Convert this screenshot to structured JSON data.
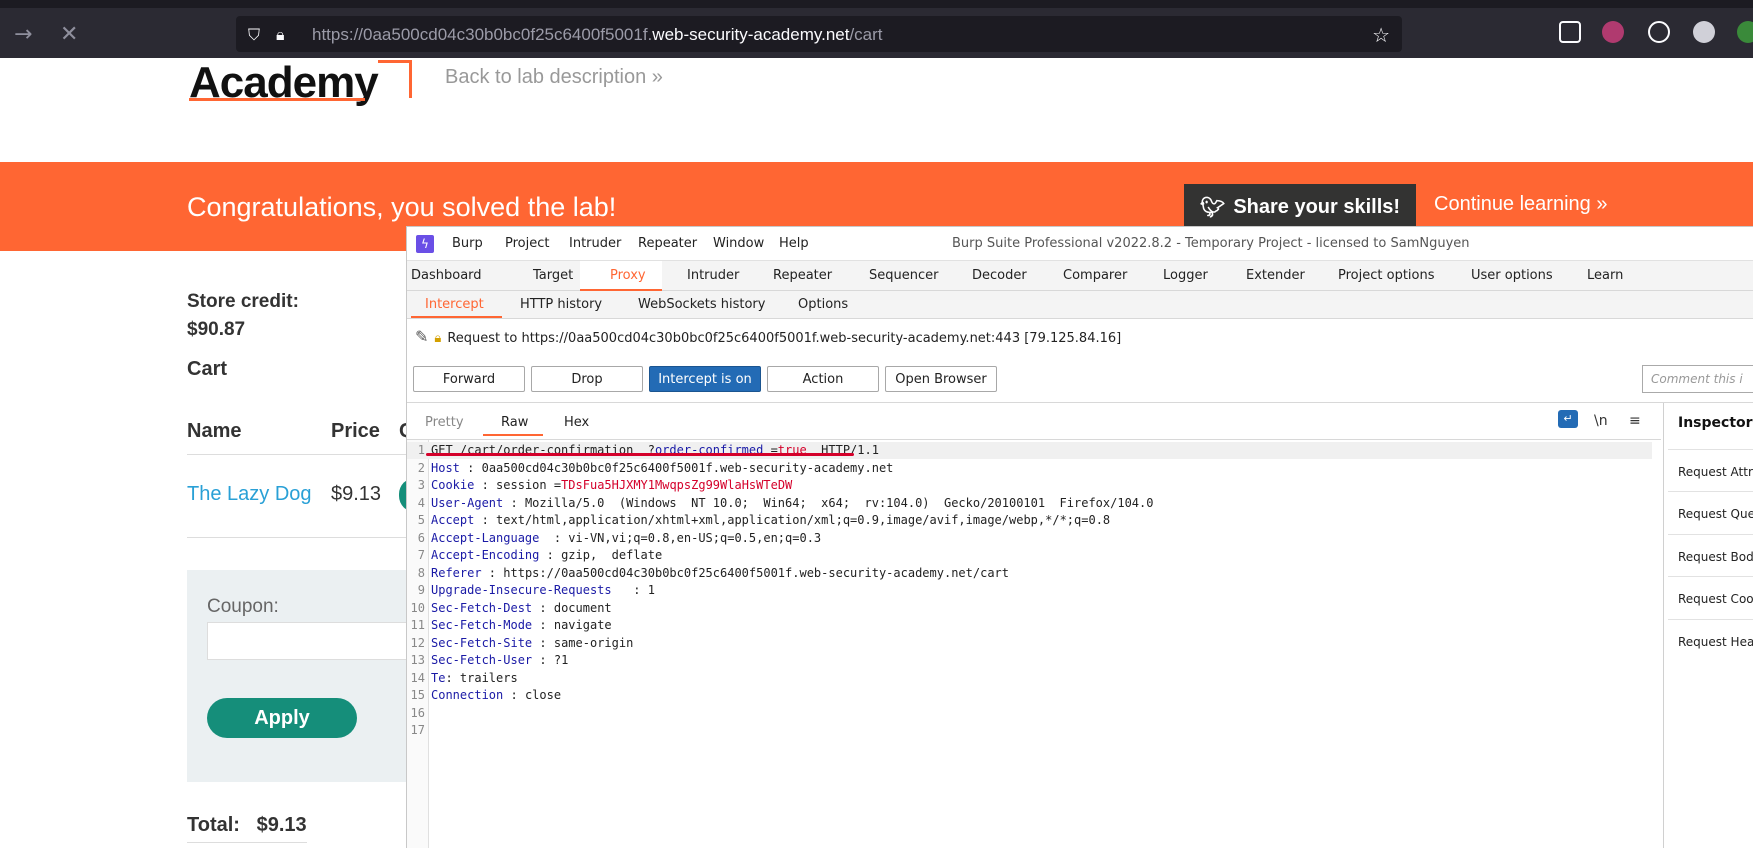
{
  "browser": {
    "url_prefix": "https://0aa500cd04c30b0bc0f25c6400f5001f.",
    "url_domain": "web-security-academy.net",
    "url_path": "/cart"
  },
  "page": {
    "logo": "Academy",
    "back_link": "Back to lab description",
    "banner_title": "Congratulations, you solved the lab!",
    "share_button": "Share your skills!",
    "continue_link": "Continue learning",
    "store_credit_label": "Store credit:",
    "store_credit_value": "$90.87",
    "cart_heading": "Cart",
    "columns": [
      "Name",
      "Price",
      "Q"
    ],
    "product_name": "The Lazy Dog",
    "product_price": "$9.13",
    "coupon_label": "Coupon:",
    "apply_button": "Apply",
    "total_label": "Total:",
    "total_value": "$9.13"
  },
  "burp": {
    "menu": [
      "Burp",
      "Project",
      "Intruder",
      "Repeater",
      "Window",
      "Help"
    ],
    "window_title": "Burp Suite Professional v2022.8.2 - Temporary Project - licensed to SamNguyen",
    "main_tabs": [
      "Dashboard",
      "Target",
      "Proxy",
      "Intruder",
      "Repeater",
      "Sequencer",
      "Decoder",
      "Comparer",
      "Logger",
      "Extender",
      "Project options",
      "User options",
      "Learn"
    ],
    "sub_tabs": [
      "Intercept",
      "HTTP history",
      "WebSockets history",
      "Options"
    ],
    "request_to": "Request to https://0aa500cd04c30b0bc0f25c6400f5001f.web-security-academy.net:443  [79.125.84.16]",
    "buttons": [
      "Forward",
      "Drop",
      "Intercept is on",
      "Action",
      "Open Browser"
    ],
    "comment_placeholder": "Comment this i",
    "view_tabs": [
      "Pretty",
      "Raw",
      "Hex"
    ],
    "newline_toggle": "\\n",
    "request_lines": [
      {
        "n": "1",
        "name": "GET /cart/order-confirmation  ?",
        "value": "order-confirmed",
        "eq": " =",
        "val2": "true",
        "tail": "  HTTP/1.1"
      },
      {
        "n": "2",
        "name": "Host",
        "sep": " : ",
        "value": "0aa500cd04c30b0bc0f25c6400f5001f.web-security-academy.net"
      },
      {
        "n": "3",
        "name": "Cookie",
        "sep": " : ",
        "value": "session =",
        "cookie": "TDsFua5HJXMY1MwqpsZg99WlaHsWTeDW"
      },
      {
        "n": "4",
        "name": "User-Agent",
        "sep": " : ",
        "value": "Mozilla/5.0  (Windows  NT 10.0;  Win64;  x64;  rv:104.0)  Gecko/20100101  Firefox/104.0"
      },
      {
        "n": "5",
        "name": "Accept",
        "sep": " : ",
        "value": "text/html,application/xhtml+xml,application/xml;q=0.9,image/avif,image/webp,*/*;q=0.8"
      },
      {
        "n": "6",
        "name": "Accept-Language",
        "sep": "  : ",
        "value": "vi-VN,vi;q=0.8,en-US;q=0.5,en;q=0.3"
      },
      {
        "n": "7",
        "name": "Accept-Encoding",
        "sep": " : ",
        "value": "gzip,  deflate"
      },
      {
        "n": "8",
        "name": "Referer",
        "sep": " : ",
        "value": "https://0aa500cd04c30b0bc0f25c6400f5001f.web-security-academy.net/cart"
      },
      {
        "n": "9",
        "name": "Upgrade-Insecure-Requests",
        "sep": "   : ",
        "value": "1"
      },
      {
        "n": "10",
        "name": "Sec-Fetch-Dest",
        "sep": " : ",
        "value": "document"
      },
      {
        "n": "11",
        "name": "Sec-Fetch-Mode",
        "sep": " : ",
        "value": "navigate"
      },
      {
        "n": "12",
        "name": "Sec-Fetch-Site",
        "sep": " : ",
        "value": "same-origin"
      },
      {
        "n": "13",
        "name": "Sec-Fetch-User",
        "sep": " : ",
        "value": "?1"
      },
      {
        "n": "14",
        "name": "Te",
        "sep": ": ",
        "value": "trailers"
      },
      {
        "n": "15",
        "name": "Connection",
        "sep": " : ",
        "value": "close"
      },
      {
        "n": "16",
        "name": "",
        "sep": "",
        "value": ""
      },
      {
        "n": "17",
        "name": "",
        "sep": "",
        "value": ""
      }
    ],
    "inspector_title": "Inspector",
    "inspector_items": [
      "Request Attr",
      "Request Que",
      "Request Bod",
      "Request Coo",
      "Request Hea"
    ]
  }
}
